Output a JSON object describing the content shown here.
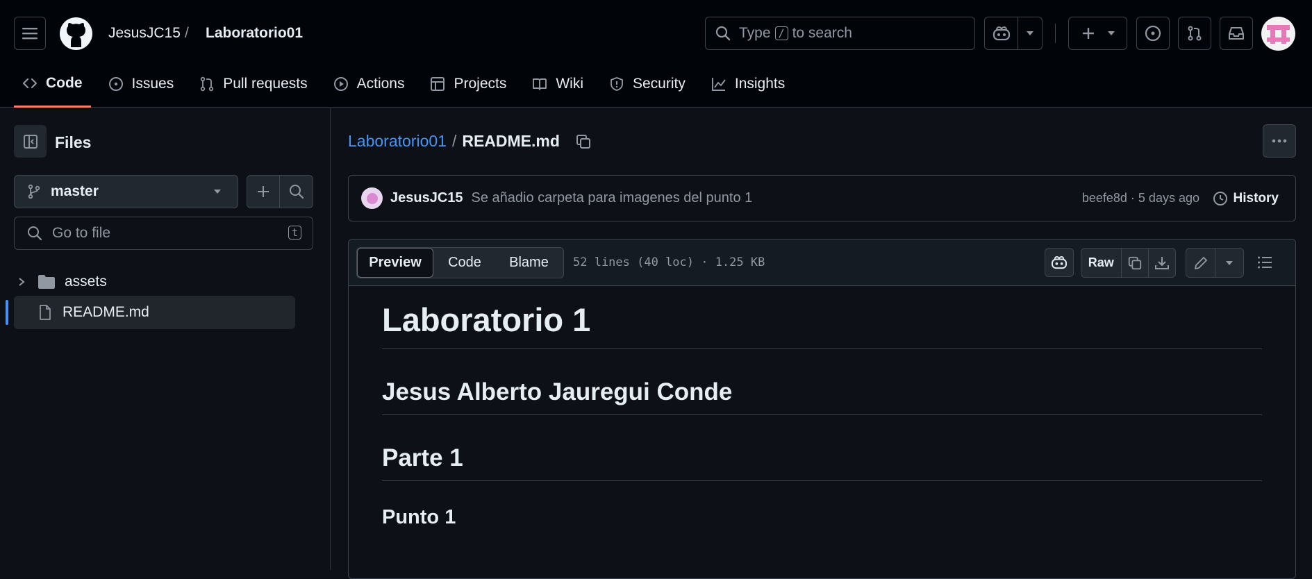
{
  "header": {
    "owner": "JesusJC15",
    "separator": "/",
    "repo": "Laboratorio01",
    "search_prefix": "Type",
    "search_key": "/",
    "search_suffix": "to search"
  },
  "tabs": [
    {
      "label": "Code"
    },
    {
      "label": "Issues"
    },
    {
      "label": "Pull requests"
    },
    {
      "label": "Actions"
    },
    {
      "label": "Projects"
    },
    {
      "label": "Wiki"
    },
    {
      "label": "Security"
    },
    {
      "label": "Insights"
    }
  ],
  "sidebar": {
    "title": "Files",
    "branch": "master",
    "goto_placeholder": "Go to file",
    "goto_key": "t",
    "tree": [
      {
        "name": "assets",
        "type": "folder"
      },
      {
        "name": "README.md",
        "type": "file"
      }
    ]
  },
  "file": {
    "breadcrumb_repo": "Laboratorio01",
    "breadcrumb_sep": "/",
    "name": "README.md",
    "commit_author": "JesusJC15",
    "commit_message": "Se añadio carpeta para imagenes del punto 1",
    "commit_meta": "beefe8d · 5 days ago",
    "history_label": "History",
    "view_tabs": [
      "Preview",
      "Code",
      "Blame"
    ],
    "info": "52 lines (40 loc) · 1.25 KB",
    "raw_label": "Raw"
  },
  "readme": {
    "h1": "Laboratorio 1",
    "h2a": "Jesus Alberto Jauregui Conde",
    "h2b": "Parte 1",
    "h3": "Punto 1"
  },
  "colors": {
    "accent": "#4493f8",
    "tab_underline": "#f78166",
    "bg": "#0d1117",
    "header_bg": "#010409"
  }
}
